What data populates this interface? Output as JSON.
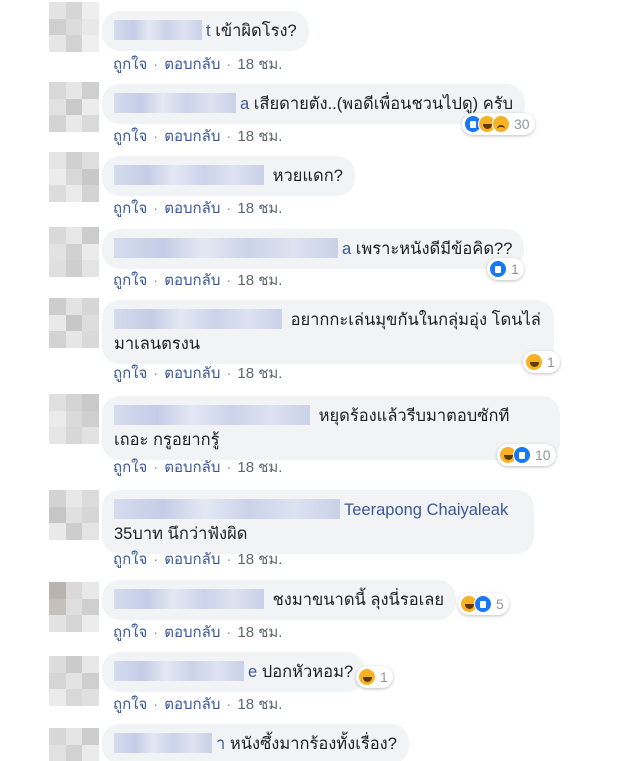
{
  "ui": {
    "like_label": "ถูกใจ",
    "reply_label": "ตอบกลับ",
    "separator": "·"
  },
  "comments": [
    {
      "name_tail": "t",
      "text_line1": "เข้าผิดโรง?",
      "text_line2": "",
      "time": "18 ชม.",
      "reactions": [],
      "reaction_count": ""
    },
    {
      "name_tail": "a",
      "text_line1": "เสียดายตัง..(พอดีเพื่อนชวนไปดู) ครับ",
      "text_line2": "",
      "time": "18 ชม.",
      "reactions": [
        "like-icon",
        "haha-icon",
        "sad-icon"
      ],
      "reaction_count": "30"
    },
    {
      "name_tail": "",
      "text_line1": "หวยแดก?",
      "text_line2": "",
      "time": "18 ชม.",
      "reactions": [],
      "reaction_count": ""
    },
    {
      "name_tail": "a",
      "text_line1": "เพราะหนังดีมีข้อคิด??",
      "text_line2": "",
      "time": "18 ชม.",
      "reactions": [
        "like-icon"
      ],
      "reaction_count": "1"
    },
    {
      "name_tail": "",
      "text_line1": "อยากกะเล่นมุขกันในกลุ่มอุ่ง โดนไล่",
      "text_line2": "มาเลนตรงน",
      "time": "18 ชม.",
      "reactions": [
        "haha-icon"
      ],
      "reaction_count": "1"
    },
    {
      "name_tail": "",
      "text_line1": "หยุดร้องแล้วรีบมาตอบซักที",
      "text_line2": "เถอะ กรูอยากรู้",
      "time": "18 ชม.",
      "reactions": [
        "haha-icon",
        "like-icon"
      ],
      "reaction_count": "10"
    },
    {
      "name_tail": "Teerapong Chaiyaleak",
      "text_line1": "",
      "text_line2": "35บาท นึกว่าฟังผิด",
      "time": "18 ชม.",
      "reactions": [],
      "reaction_count": ""
    },
    {
      "name_tail": "",
      "text_line1": "ชงมาขนาดนี้ ลุงนี่รอเลย",
      "text_line2": "",
      "time": "18 ชม.",
      "reactions": [
        "haha-icon",
        "like-icon"
      ],
      "reaction_count": "5"
    },
    {
      "name_tail": "e",
      "text_line1": "ปอกหัวหอม?",
      "text_line2": "",
      "time": "18 ชม.",
      "reactions": [
        "haha-icon"
      ],
      "reaction_count": "1"
    },
    {
      "name_tail": "า",
      "text_line1": "หนังซึ้งมากร้องทั้งเรื่อง?",
      "text_line2": "",
      "time": "",
      "reactions": [],
      "reaction_count": ""
    }
  ]
}
